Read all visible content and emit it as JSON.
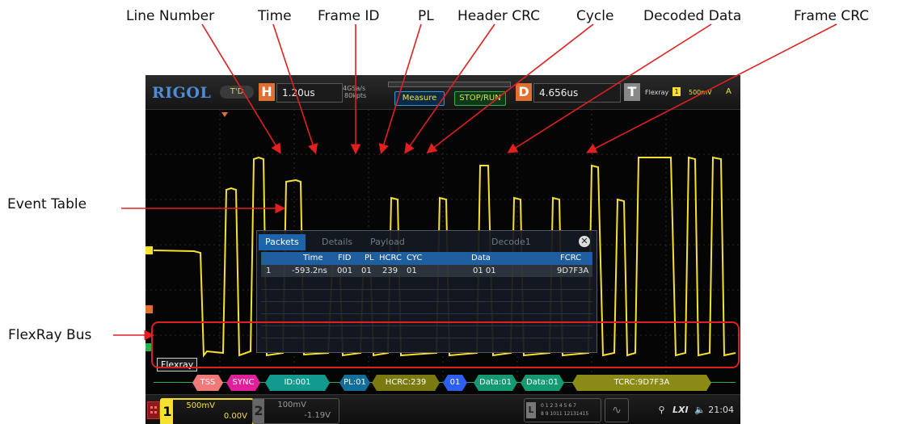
{
  "callouts": {
    "line_number": "Line Number",
    "time": "Time",
    "frame_id": "Frame ID",
    "pl": "PL",
    "header_crc": "Header CRC",
    "cycle": "Cycle",
    "decoded_data": "Decoded Data",
    "frame_crc": "Frame CRC",
    "event_table": "Event Table",
    "flexray_bus": "FlexRay Bus"
  },
  "topbar": {
    "logo": "RIGOL",
    "run_state": "T'D",
    "h_badge": "H",
    "timebase": "1.20us",
    "sample_rate": "4GSa/s",
    "mem_depth": "80kpts",
    "measure_btn": "Measure",
    "stop_run_btn": "STOP/RUN",
    "d_badge": "D",
    "delay": "4.656us",
    "t_badge": "T",
    "trigger_type": "Flexray",
    "trigger_level": "500mV",
    "trigger_mode": "A"
  },
  "event_table": {
    "tabs": [
      "Packets",
      "Details",
      "Payload",
      "Decode1"
    ],
    "active_tab": "Packets",
    "columns": [
      "Time",
      "FID",
      "PL",
      "HCRC",
      "CYC",
      "Data",
      "FCRC"
    ],
    "rows": [
      {
        "line": "1",
        "time": "-593.2ns",
        "fid": "001",
        "pl": "01",
        "hcrc": "239",
        "cyc": "01",
        "data": "01 01",
        "fcrc": "9D7F3A"
      }
    ]
  },
  "bus": {
    "label": "Flexray",
    "segments": [
      {
        "text": "TSS",
        "color": "#f07a7a"
      },
      {
        "text": "SYNC",
        "color": "#e0209a"
      },
      {
        "text": "ID:001",
        "color": "#139a8e"
      },
      {
        "text": "PL:01",
        "color": "#146e9a"
      },
      {
        "text": "HCRC:239",
        "color": "#7a7a12"
      },
      {
        "text": "01",
        "color": "#2f5ff0"
      },
      {
        "text": "Data:01",
        "color": "#139a72"
      },
      {
        "text": "Data:01",
        "color": "#139a72"
      },
      {
        "text": "TCRC:9D7F3A",
        "color": "#8a8a14"
      }
    ]
  },
  "bottom": {
    "ch1_num": "1",
    "ch1_scale": "500mV",
    "ch1_offset": "0.00V",
    "ch2_num": "2",
    "ch2_scale": "100mV",
    "ch2_offset": "-1.19V",
    "digital_top": "0 1 2 3  4 5 6 7",
    "digital_bottom": "8 9 1011 12131415",
    "clock": "21:04"
  },
  "colors": {
    "trace": "#f6e12c",
    "h_badge": "#e07030",
    "annotation": "#e02020"
  }
}
